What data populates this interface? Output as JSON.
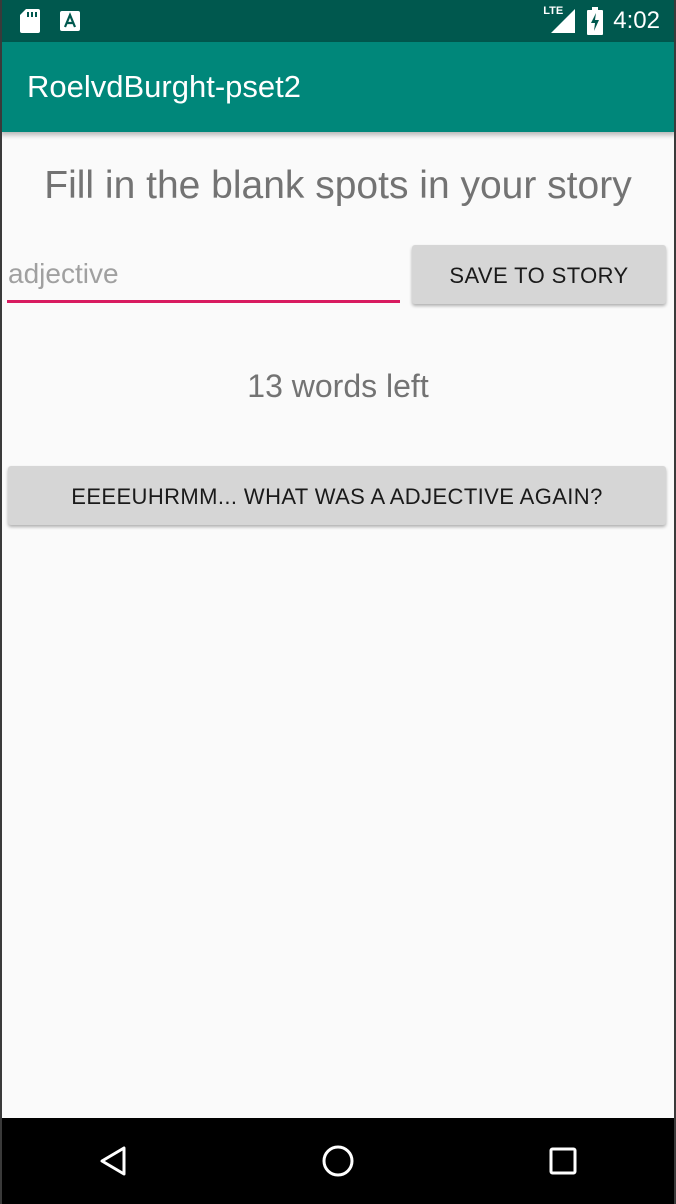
{
  "status_bar": {
    "network_label": "LTE",
    "time": "4:02",
    "icons": [
      "sd-card-icon",
      "a-notification-icon",
      "signal-icon",
      "battery-icon"
    ]
  },
  "app_bar": {
    "title": "RoelvdBurght-pset2"
  },
  "main": {
    "heading": "Fill in the blank spots in your story",
    "word_input": {
      "value": "",
      "placeholder": "adjective"
    },
    "save_button_label": "SAVE TO STORY",
    "words_left": "13 words left",
    "help_button_label": "EEEEUHRMM... WHAT WAS A ADJECTIVE AGAIN?"
  },
  "nav_bar": {
    "icons": [
      "back-icon",
      "home-icon",
      "recents-icon"
    ]
  },
  "colors": {
    "status_bar": "#00584e",
    "app_bar": "#00877a",
    "accent": "#d81b60",
    "button": "#d6d6d6",
    "background": "#fafafa"
  }
}
